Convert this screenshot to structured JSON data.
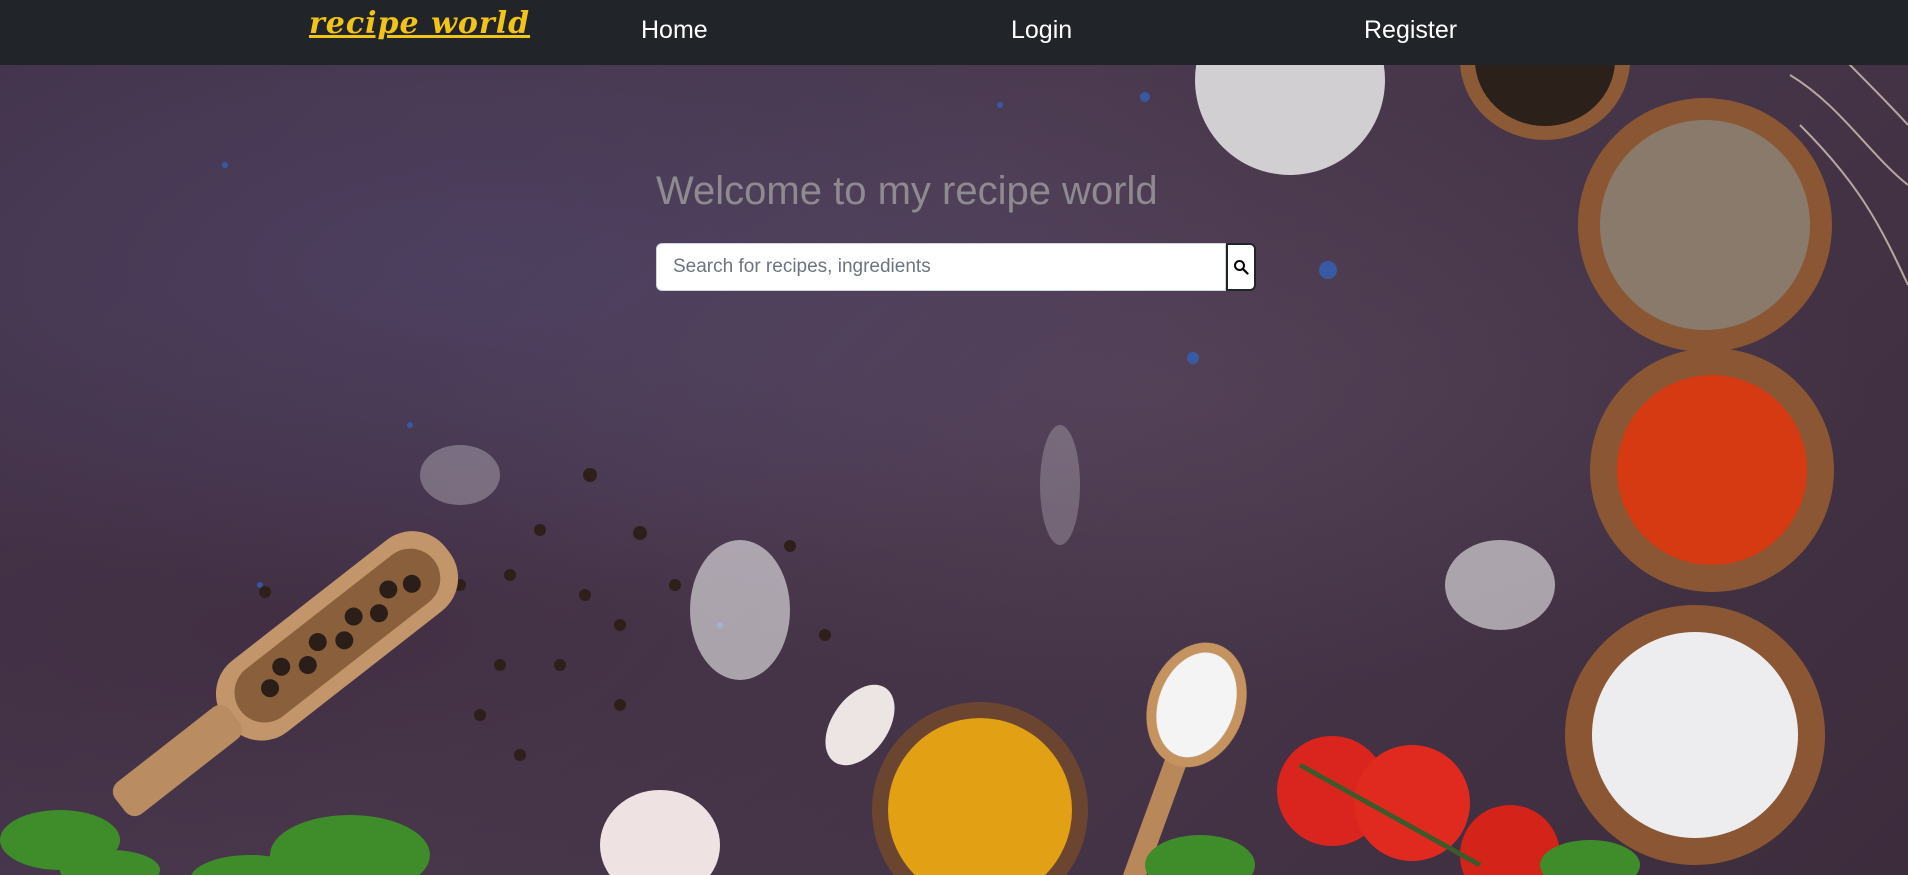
{
  "navbar": {
    "brand": "recipe world",
    "links": [
      {
        "label": "Home"
      },
      {
        "label": "Login"
      },
      {
        "label": "Register"
      }
    ]
  },
  "hero": {
    "title": "Welcome to my recipe world",
    "search": {
      "placeholder": "Search for recipes, ingredients",
      "value": "",
      "button_icon": "search-icon"
    },
    "background": "spices-on-dark-table"
  },
  "colors": {
    "navbar_bg": "#212529",
    "brand": "#f2c418",
    "nav_text": "#ffffff",
    "title": "#8f8a8f"
  }
}
